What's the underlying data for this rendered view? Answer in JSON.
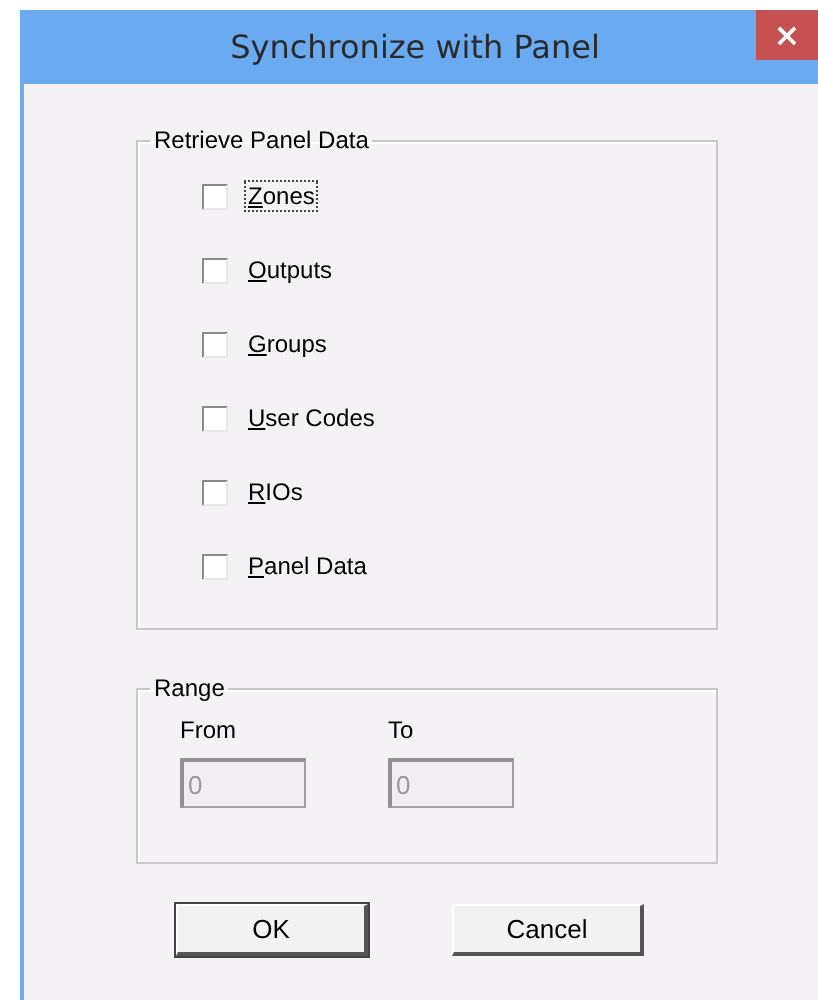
{
  "window": {
    "title": "Synchronize with Panel",
    "close": "×"
  },
  "retrieve_group": {
    "label": "Retrieve Panel Data",
    "options": [
      {
        "label": "Zones",
        "checked": false,
        "focused": true
      },
      {
        "label": "Outputs",
        "checked": false,
        "focused": false
      },
      {
        "label": "Groups",
        "checked": false,
        "focused": false
      },
      {
        "label": "User Codes",
        "checked": false,
        "focused": false
      },
      {
        "label": "RIOs",
        "checked": false,
        "focused": false
      },
      {
        "label": "Panel Data",
        "checked": false,
        "focused": false
      }
    ]
  },
  "range_group": {
    "label": "Range",
    "fields": [
      {
        "label": "From",
        "value": "0",
        "disabled": true
      },
      {
        "label": "To",
        "value": "0",
        "disabled": true
      }
    ]
  },
  "buttons": [
    {
      "label": "OK",
      "default": true
    },
    {
      "label": "Cancel",
      "default": false
    }
  ]
}
